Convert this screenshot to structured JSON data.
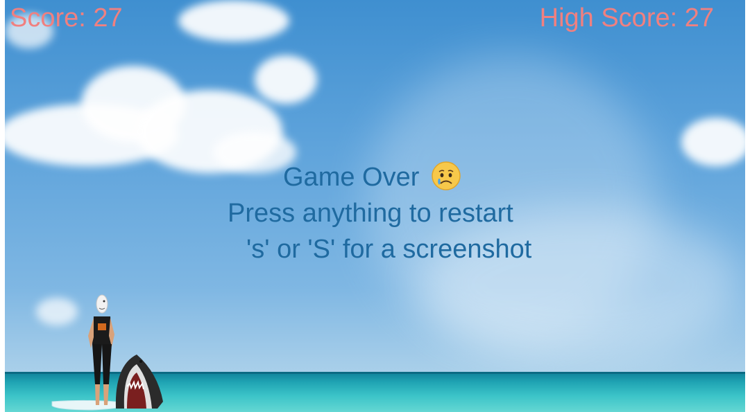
{
  "hud": {
    "score_label": "Score: 27",
    "high_score_label": "High Score: 27"
  },
  "game_over": {
    "title": "Game Over",
    "emoji_icon": "crying-face-icon",
    "restart_hint": "Press anything to restart",
    "screenshot_hint": "'s' or 'S' for a screenshot"
  },
  "colors": {
    "score_text": "#f08080",
    "message_text": "#1f6aa0",
    "sky": "#5ea3db",
    "ocean": "#3cc4c8"
  }
}
